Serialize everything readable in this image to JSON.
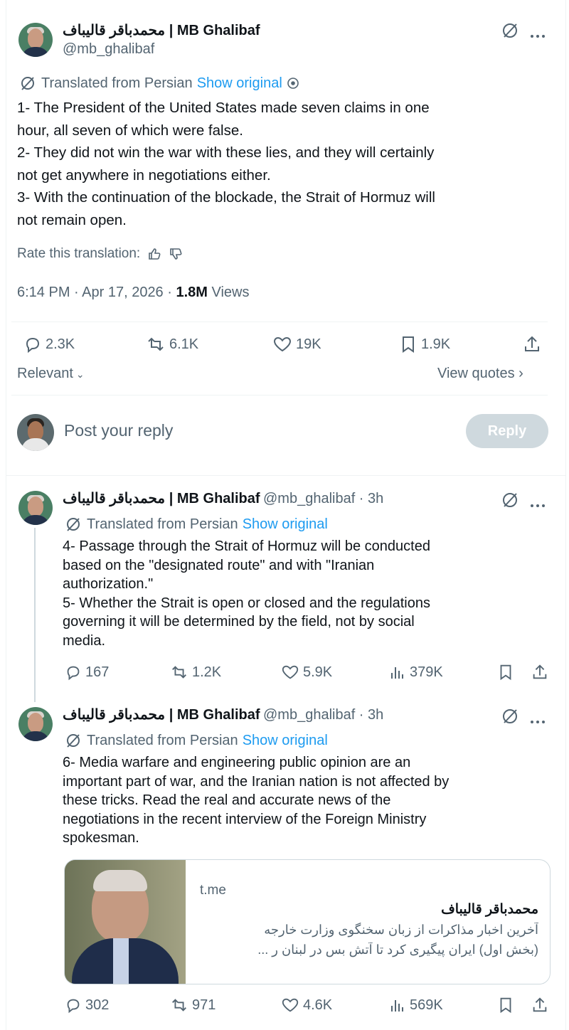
{
  "main_tweet": {
    "display_name": "محمدباقر قالیباف | MB Ghalibaf",
    "handle": "@mb_ghalibaf",
    "translated_label": "Translated from Persian",
    "show_original": "Show original",
    "text": "1- The President of the United States made seven claims in one\nhour, all seven of which were false.\n2- They did not win the war with these lies, and they will certainly\nnot get anywhere in negotiations either.\n3- With the continuation of the blockade, the Strait of Hormuz will\nnot remain open.",
    "rate_label": "Rate this translation:",
    "timestamp": "6:14 PM · Apr 17, 2026 · ",
    "views_count": "1.8M",
    "views_label": " Views",
    "stats": {
      "replies": "2.3K",
      "reposts": "6.1K",
      "likes": "19K",
      "bookmarks": "1.9K"
    },
    "sort_label": "Relevant",
    "view_quotes": "View quotes"
  },
  "compose": {
    "placeholder": "Post your reply",
    "reply_button": "Reply"
  },
  "replies": [
    {
      "display_name": "محمدباقر قالیباف | MB Ghalibaf",
      "handle_time": "@mb_ghalibaf · 3h",
      "translated_label": "Translated from Persian",
      "show_original": "Show original",
      "text": "4- Passage through the Strait of Hormuz will be conducted\nbased on the \"designated route\" and with \"Iranian\nauthorization.\"\n5- Whether the Strait is open or closed and the regulations\ngoverning it will be determined by the field, not by social\nmedia.",
      "stats": {
        "replies": "167",
        "reposts": "1.2K",
        "likes": "5.9K",
        "views": "379K"
      }
    },
    {
      "display_name": "محمدباقر قالیباف | MB Ghalibaf",
      "handle_time": "@mb_ghalibaf · 3h",
      "translated_label": "Translated from Persian",
      "show_original": "Show original",
      "text": "6- Media warfare and engineering public opinion are an\nimportant part of war, and the Iranian nation is not affected by\nthese tricks. Read the real and accurate news of the\nnegotiations in the recent interview of the Foreign Ministry\nspokesman.",
      "card": {
        "domain": "t.me",
        "title": "محمدباقر قالیباف",
        "line1": "آخرین اخبار مذاکرات از زبان سخنگوی وزارت خارجه",
        "line2": "(بخش اول) ایران پیگیری کرد تا آتش بس در لبنان ر ..."
      },
      "stats": {
        "replies": "302",
        "reposts": "971",
        "likes": "4.6K",
        "views": "569K"
      }
    }
  ]
}
